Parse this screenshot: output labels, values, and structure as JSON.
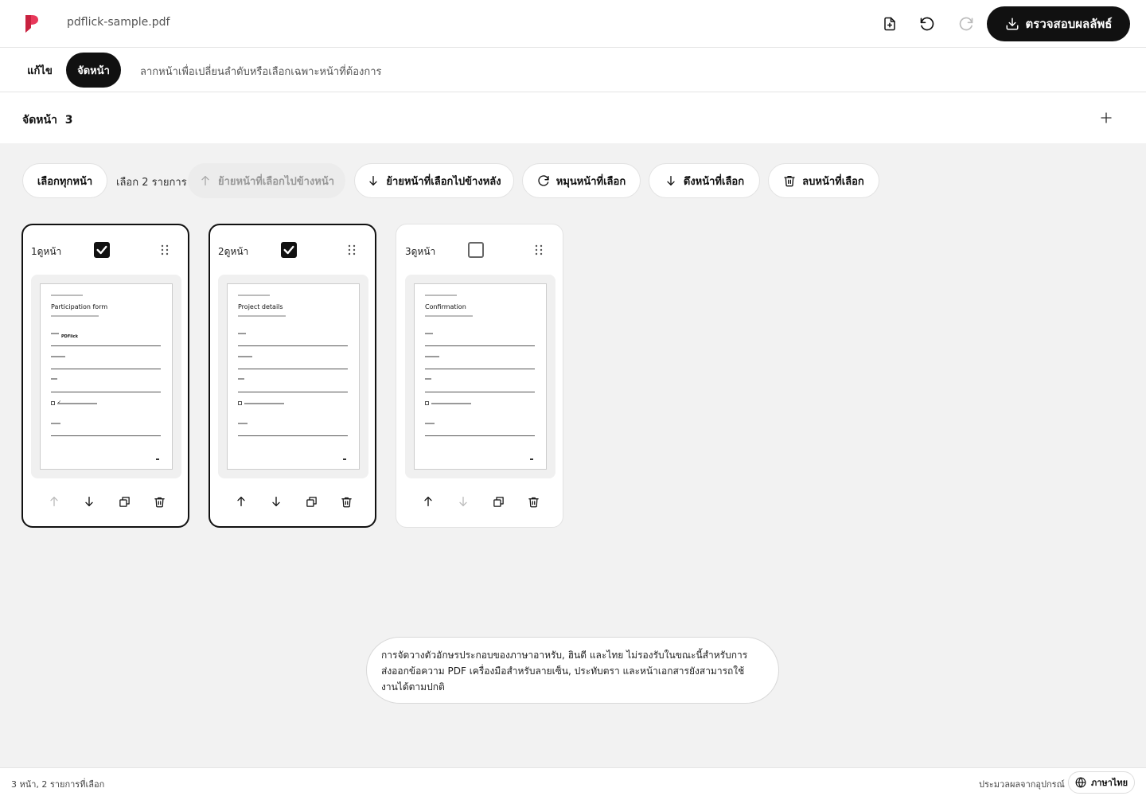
{
  "header": {
    "filename": "pdflick-sample.pdf",
    "primary_button_label": "ตรวจสอบผลลัพธ์",
    "brand_color": "#e8385a"
  },
  "tabs": {
    "edit_label": "แก้ไข",
    "arrange_label": "จัดหน้า",
    "hint": "ลากหน้าเพื่อเปลี่ยนลำดับหรือเลือกเฉพาะหน้าที่ต้องการ"
  },
  "section": {
    "title": "จัดหน้า  3"
  },
  "toolbar": {
    "select_all": "เลือกทุกหน้า",
    "selected_count": "เลือก 2 รายการ",
    "move_forward": "ย้ายหน้าที่เลือกไปข้างหน้า",
    "move_backward": "ย้ายหน้าที่เลือกไปข้างหลัง",
    "rotate": "หมุนหน้าที่เลือก",
    "extract": "ดึงหน้าที่เลือก",
    "delete": "ลบหน้าที่เลือก"
  },
  "pages": [
    {
      "label": "1ดูหน้า",
      "checked": true,
      "title": "Participation form",
      "value": "PDFlick",
      "check_mark": "✓"
    },
    {
      "label": "2ดูหน้า",
      "checked": true,
      "title": "Project details"
    },
    {
      "label": "3ดูหน้า",
      "checked": false,
      "title": "Confirmation"
    }
  ],
  "notice": "การจัดวางตัวอักษรประกอบของภาษาอาหรับ, ฮินดี และไทย ไม่รองรับในขณะนี้สำหรับการส่งออกข้อความ PDF เครื่องมือสำหรับลายเซ็น, ประทับตรา และหน้าเอกสารยังสามารถใช้งานได้ตามปกติ",
  "footer": {
    "status": "3 หน้า, 2 รายการที่เลือก",
    "local_processing": "ประมวลผลจากอุปกรณ์",
    "language": "ภาษาไทย"
  }
}
